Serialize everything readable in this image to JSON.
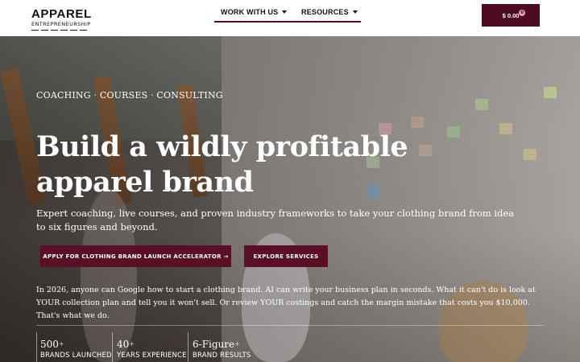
{
  "logo": {
    "main": "APPAREL",
    "sub": "ENTREPRENEURSHIP"
  },
  "nav": {
    "items": [
      {
        "label": "WORK WITH US"
      },
      {
        "label": "RESOURCES"
      }
    ]
  },
  "cart": {
    "price": "$ 0.00",
    "count": "0"
  },
  "hero": {
    "kicker": "COACHING · COURSES · CONSULTING",
    "headline": "Build a wildly profitable apparel brand",
    "subhead": "Expert coaching, live courses, and proven industry frameworks to take your clothing brand from idea to six figures and beyond.",
    "primary_cta": "APPLY FOR CLOTHING BRAND LAUNCH ACCELERATOR →",
    "secondary_cta": "EXPLORE SERVICES",
    "body": "In 2026, anyone can Google how to start a clothing brand. AI can write your business plan in seconds. What it can't do is look at YOUR collection plan and tell you it won't sell. Or review YOUR costings and catch the margin mistake that costs you $10,000. That's what we do.",
    "stats": [
      {
        "value": "500",
        "suffix": "+",
        "label": "BRANDS LAUNCHED"
      },
      {
        "value": "40",
        "suffix": "+",
        "label": "YEARS EXPERIENCE"
      },
      {
        "value": "6-Figure",
        "suffix": "+",
        "label": "BRAND RESULTS"
      }
    ]
  },
  "colors": {
    "brand": "#5a0f26",
    "cart_bg": "#4e0c22",
    "text_on_dark": "#ffffff"
  }
}
